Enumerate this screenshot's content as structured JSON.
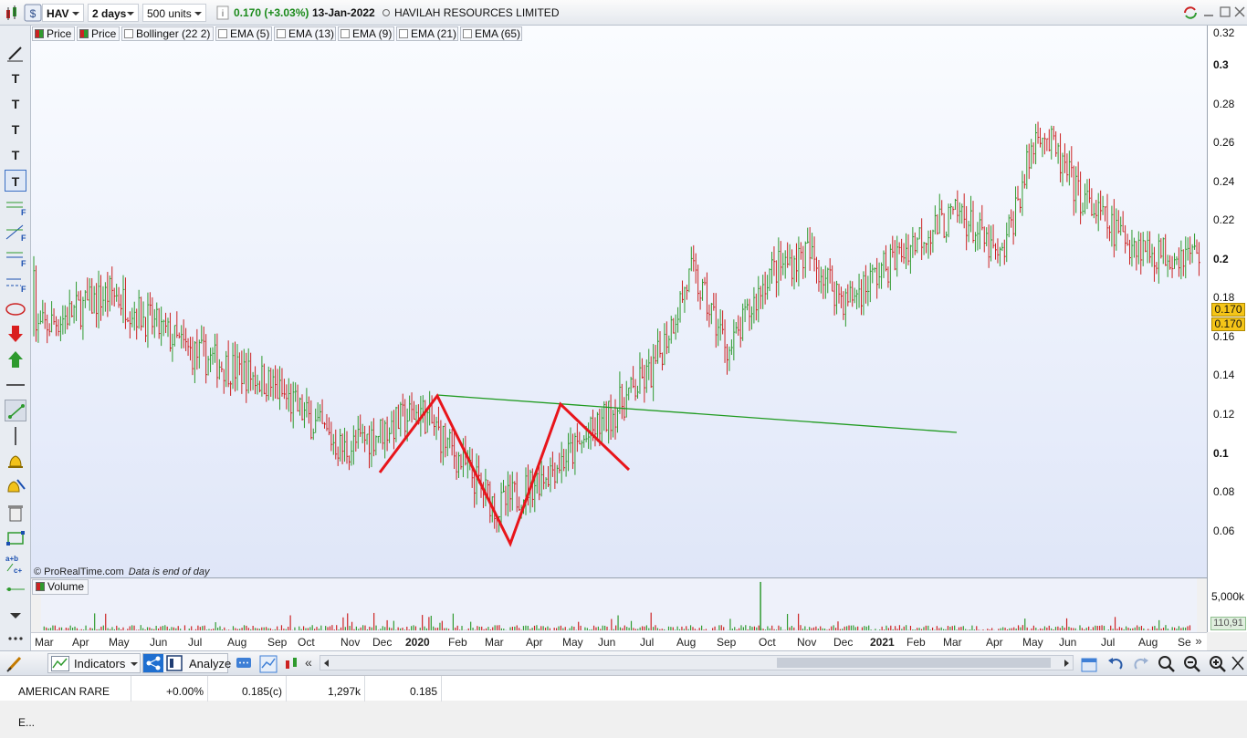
{
  "toolbar": {
    "symbol": "HAV",
    "period": "2 days",
    "units": "500 units",
    "price_change": "0.170 (+3.03%)",
    "date": "13-Jan-2022",
    "instrument_name": "HAVILAH RESOURCES LIMITED"
  },
  "legend": [
    "Price",
    "Price",
    "Bollinger (22 2)",
    "EMA (5)",
    "EMA (13)",
    "EMA (9)",
    "EMA (21)",
    "EMA (65)"
  ],
  "watermark": "© ProRealTime.com",
  "watermark_note": "Data is end of day",
  "y_axis_labels": [
    "0.32",
    "0.3",
    "0.28",
    "0.26",
    "0.24",
    "0.22",
    "0.2",
    "0.18",
    "0.16",
    "0.14",
    "0.12",
    "0.1",
    "0.08",
    "0.06"
  ],
  "price_badges": [
    "0.170",
    "0.170"
  ],
  "volume": {
    "label": "Volume",
    "axis_label": "5,000k",
    "last_value": "110,91"
  },
  "x_axis_labels": [
    "Mar",
    "Apr",
    "May",
    "Jun",
    "Jul",
    "Aug",
    "Sep",
    "Oct",
    "Nov",
    "Dec",
    "2020",
    "Feb",
    "Mar",
    "Apr",
    "May",
    "Jun",
    "Jul",
    "Aug",
    "Sep",
    "Oct",
    "Nov",
    "Dec",
    "2021",
    "Feb",
    "Mar",
    "Apr",
    "May",
    "Jun",
    "Jul",
    "Aug",
    "Se"
  ],
  "bottom": {
    "indicators_label": "Indicators",
    "analyze_label": "Analyze"
  },
  "status": {
    "name": "AMERICAN RARE E...",
    "change": "+0.00%",
    "price": "0.185(c)",
    "volume": "1,297k",
    "last": "0.185"
  },
  "colors": {
    "up": "#2e9a2e",
    "down": "#cc2222",
    "pattern": "#e8151b",
    "trendline": "#1f9a1f",
    "badge": "#f5c518",
    "chart_bg_top": "#f9fbff",
    "chart_bg_bottom": "#dde4f7"
  },
  "chart_data": {
    "type": "ohlc",
    "series": [
      {
        "name": "Price",
        "ticker": "HAV"
      }
    ],
    "key_points": {
      "close_shoulders_pattern": [
        {
          "date": "Dec 2019",
          "price": 0.09
        },
        {
          "date": "Jan 2020",
          "price": 0.13
        },
        {
          "date": "Mar 2020",
          "price": 0.053
        },
        {
          "date": "Apr 2020",
          "price": 0.125
        },
        {
          "date": "Jun 2020",
          "price": 0.091
        }
      ],
      "neckline": [
        {
          "date": "Jan 2020",
          "price": 0.13
        },
        {
          "date": "Mar 2021",
          "price": 0.11
        }
      ],
      "approx_closes": [
        {
          "date": "Mar 2019",
          "price": 0.16
        },
        {
          "date": "May 2019",
          "price": 0.18
        },
        {
          "date": "Jul 2019",
          "price": 0.15
        },
        {
          "date": "Sep 2019",
          "price": 0.135
        },
        {
          "date": "Nov 2019",
          "price": 0.1
        },
        {
          "date": "Jan 2020",
          "price": 0.12
        },
        {
          "date": "Mar 2020",
          "price": 0.07
        },
        {
          "date": "May 2020",
          "price": 0.1
        },
        {
          "date": "Jul 2020",
          "price": 0.14
        },
        {
          "date": "Aug 2020",
          "price": 0.19
        },
        {
          "date": "Sep 2020",
          "price": 0.15
        },
        {
          "date": "Oct 2020",
          "price": 0.19
        },
        {
          "date": "Nov 2020",
          "price": 0.2
        },
        {
          "date": "Dec 2020",
          "price": 0.175
        },
        {
          "date": "Feb 2021",
          "price": 0.21
        },
        {
          "date": "Mar 2021",
          "price": 0.22
        },
        {
          "date": "Apr 2021",
          "price": 0.195
        },
        {
          "date": "May 2021",
          "price": 0.265
        },
        {
          "date": "Jun 2021",
          "price": 0.23
        },
        {
          "date": "Jul 2021",
          "price": 0.21
        },
        {
          "date": "Aug 2021",
          "price": 0.2
        },
        {
          "date": "Sep 2021",
          "price": 0.2
        }
      ]
    },
    "ylim": [
      0.04,
      0.32
    ]
  }
}
